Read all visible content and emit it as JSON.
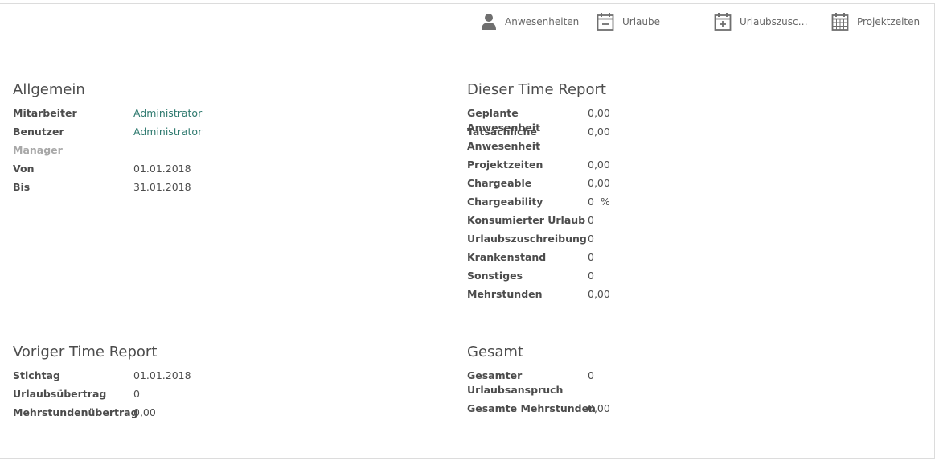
{
  "buttons": [
    {
      "label": "Anwesenheiten",
      "icon": "user-icon"
    },
    {
      "label": "Urlaube",
      "icon": "calendar-minus-icon"
    },
    {
      "label": "Urlaubszuschr...",
      "icon": "calendar-plus-icon"
    },
    {
      "label": "Projektzeiten",
      "icon": "calendar-grid-icon"
    }
  ],
  "allgemein": {
    "title": "Allgemein",
    "rows": [
      {
        "label": "Mitarbeiter",
        "value": "Administrator"
      },
      {
        "label": "Benutzer",
        "value": "Administrator"
      },
      {
        "label": "Manager",
        "value": ""
      },
      {
        "label": "Von",
        "value": "01.01.2018"
      },
      {
        "label": "Bis",
        "value": "31.01.2018"
      }
    ]
  },
  "dieser": {
    "title": "Dieser Time Report",
    "rows": [
      {
        "label": "Geplante Anwesenheit",
        "value": "0,00"
      },
      {
        "label": "Tatsächliche Anwesenheit",
        "value": "0,00"
      },
      {
        "label": "Projektzeiten",
        "value": "0,00"
      },
      {
        "label": "Chargeable",
        "value": "0,00"
      },
      {
        "label": "Chargeability",
        "value": "0  %"
      },
      {
        "label": "Konsumierter Urlaub",
        "value": "0"
      },
      {
        "label": "Urlaubszuschreibung",
        "value": "0"
      },
      {
        "label": "Krankenstand",
        "value": "0"
      },
      {
        "label": "Sonstiges",
        "value": "0"
      },
      {
        "label": "Mehrstunden",
        "value": "0,00"
      }
    ]
  },
  "voriger": {
    "title": "Voriger Time Report",
    "rows": [
      {
        "label": "Stichtag",
        "value": "01.01.2018"
      },
      {
        "label": "Urlaubsübertrag",
        "value": "0"
      },
      {
        "label": "Mehrstundenübertrag",
        "value": "0,00"
      }
    ]
  },
  "gesamt": {
    "title": "Gesamt",
    "rows": [
      {
        "label": "Gesamter Urlaubsanspruch",
        "value": "0"
      },
      {
        "label": "Gesamte Mehrstunden",
        "value": "0,00"
      }
    ]
  },
  "colors": {
    "link": "#2f7a6f",
    "text": "#4c4c4c",
    "muted": "#a8a8a8",
    "border": "#dcdcdc"
  }
}
